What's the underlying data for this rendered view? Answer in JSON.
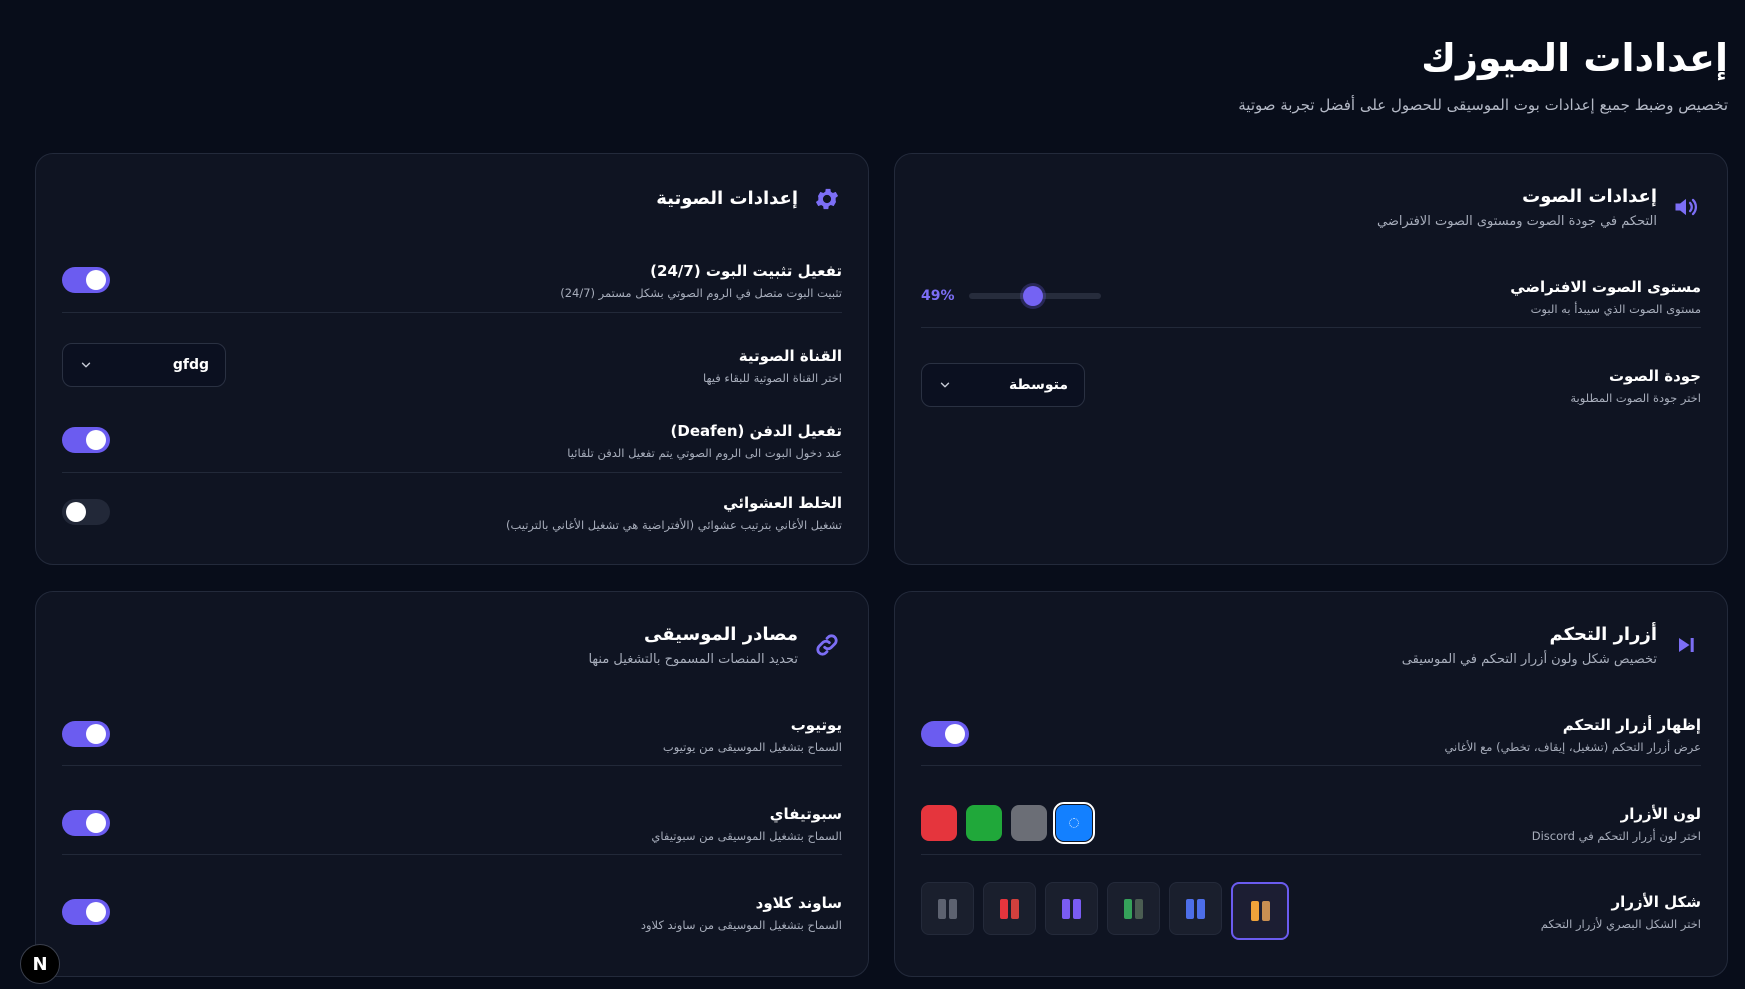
{
  "page": {
    "title": "إعدادات الميوزك",
    "subtitle": "تخصيص وضبط جميع إعدادات بوت الموسيقى للحصول على أفضل تجربة صوتية"
  },
  "voice_settings": {
    "title": "إعدادات الصوتية",
    "icon": "gear-icon",
    "rows": [
      {
        "title": "تفعيل تثبيت البوت (24/7)",
        "desc": "تثبيت البوت متصل في الروم الصوتي بشكل مستمر (24/7)",
        "enabled": true
      },
      {
        "title": "القناة الصوتية",
        "desc": "اختر القناة الصوتية للبقاء فيها",
        "value": "gfdg"
      },
      {
        "title": "تفعيل الدفن (Deafen)",
        "desc": "عند دخول البوت الى الروم الصوتي يتم تفعيل الدفن تلقائيا",
        "enabled": true
      },
      {
        "title": "الخلط العشوائي",
        "desc": "تشغيل الأغاني بترتيب عشوائي (الأفتراضية هي تشغيل الأغاني بالترتيب)",
        "enabled": false
      }
    ]
  },
  "audio_settings": {
    "title": "إعدادات الصوت",
    "desc": "التحكم في جودة الصوت ومستوى الصوت الافتراضي",
    "icon": "speaker-icon",
    "volume": {
      "title": "مستوى الصوت الافتراضي",
      "desc": "مستوى الصوت الذي سيبدأ به البوت",
      "value": 49,
      "label": "49%"
    },
    "quality": {
      "title": "جودة الصوت",
      "desc": "اختر جودة الصوت المطلوبة",
      "value": "متوسطة"
    }
  },
  "music_sources": {
    "title": "مصادر الموسيقى",
    "desc": "تحديد المنصات المسموح بالتشغيل منها",
    "icon": "link-icon",
    "rows": [
      {
        "title": "يوتيوب",
        "desc": "السماح بتشغيل الموسيقى من يوتيوب",
        "enabled": true
      },
      {
        "title": "سبوتيفاي",
        "desc": "السماح بتشغيل الموسيقى من سبوتيفاي",
        "enabled": true
      },
      {
        "title": "ساوند كلاود",
        "desc": "السماح بتشغيل الموسيقى من ساوند كلاود",
        "enabled": true
      }
    ]
  },
  "controls": {
    "title": "أزرار التحكم",
    "desc": "تخصيص شكل ولون أزرار التحكم في الموسيقى",
    "icon": "skip-forward-icon",
    "show": {
      "title": "إظهار أزرار التحكم",
      "desc": "عرض أزرار التحكم (تشغيل، إيقاف، تخطي) مع الأغاني",
      "enabled": true
    },
    "color": {
      "title": "لون الأزرار",
      "desc": "اختر لون أزرار التحكم في Discord",
      "options": [
        "#e5353d",
        "#20a83a",
        "#6b6e76",
        "#1380ff"
      ],
      "selected": 3
    },
    "shape": {
      "title": "شكل الأزرار",
      "desc": "اختر الشكل البصري لأزرار التحكم",
      "selected": 5,
      "options": [
        [
          "#5d6270",
          "#5d6270"
        ],
        [
          "#e5353d",
          "#d1403d"
        ],
        [
          "#7a5cf2",
          "#7a5cf2"
        ],
        [
          "#35a25a",
          "#4b5d52"
        ],
        [
          "#4d6ee8",
          "#4d6ee8"
        ],
        [
          "#f0a33a",
          "#c98f52"
        ]
      ]
    }
  },
  "corner_badge": "N"
}
